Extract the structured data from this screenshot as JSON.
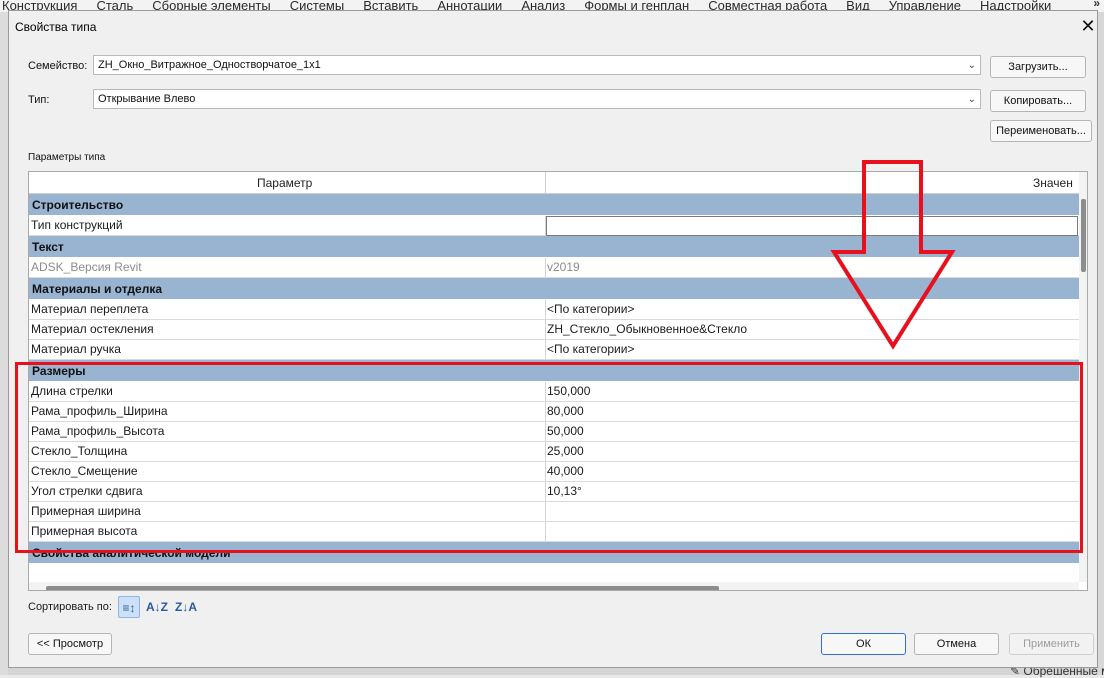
{
  "ribbon": {
    "tabs": [
      "Конструкция",
      "Сталь",
      "Сборные элементы",
      "Системы",
      "Вставить",
      "Аннотации",
      "Анализ",
      "Формы и генплан",
      "Совместная работа",
      "Вид",
      "Управление",
      "Надстройки"
    ],
    "overflow_icon": "double-chevron-right-icon",
    "right_glyph": "»"
  },
  "background": {
    "bottom_right_text": "✎ Обрешенные м"
  },
  "dialog": {
    "title": "Свойства типа",
    "close_glyph": "✕",
    "family_label": "Семейство:",
    "family_value": "ZH_Окно_Витражное_Одностворчатое_1х1",
    "type_label": "Тип:",
    "type_value": "Открывание Влево",
    "load_button": "Загрузить...",
    "duplicate_button": "Копировать...",
    "rename_button": "Переименовать...",
    "type_params_label": "Параметры типа",
    "columns": {
      "param": "Параметр",
      "value": "Значен"
    },
    "groups": [
      {
        "name": "Строительство",
        "rows": [
          {
            "param": "Тип конструкций",
            "value": "",
            "editing": true
          }
        ]
      },
      {
        "name": "Текст",
        "rows": [
          {
            "param": "ADSK_Версия Revit",
            "value": "v2019",
            "readonly": true
          }
        ]
      },
      {
        "name": "Материалы и отделка",
        "rows": [
          {
            "param": "Материал переплета",
            "value": "<По категории>"
          },
          {
            "param": "Материал остекления",
            "value": "ZH_Стекло_Обыкновенное&Стекло"
          },
          {
            "param": "Материал ручка",
            "value": "<По категории>"
          }
        ]
      },
      {
        "name": "Размеры",
        "rows": [
          {
            "param": "Длина стрелки",
            "value": "150,000"
          },
          {
            "param": "Рама_профиль_Ширина",
            "value": "80,000"
          },
          {
            "param": "Рама_профиль_Высота",
            "value": "50,000"
          },
          {
            "param": "Стекло_Толщина",
            "value": "25,000"
          },
          {
            "param": "Стекло_Смещение",
            "value": "40,000"
          },
          {
            "param": "Угол стрелки сдвига",
            "value": "10,13°"
          },
          {
            "param": "Примерная ширина",
            "value": ""
          },
          {
            "param": "Примерная высота",
            "value": ""
          }
        ]
      },
      {
        "name": "Свойства аналитической модели",
        "rows": []
      }
    ],
    "sort_label": "Сортировать по:",
    "sort_icons": [
      "sort-as-table-icon",
      "sort-ascending-icon",
      "sort-descending-icon"
    ],
    "sort_glyphs": [
      "≡↕",
      "A↓Z",
      "Z↓A"
    ],
    "preview_button": "<< Просмотр",
    "ok_button": "ОК",
    "cancel_button": "Отмена",
    "apply_button": "Применить"
  },
  "annotations": {
    "highlight_color": "#e8101c"
  }
}
